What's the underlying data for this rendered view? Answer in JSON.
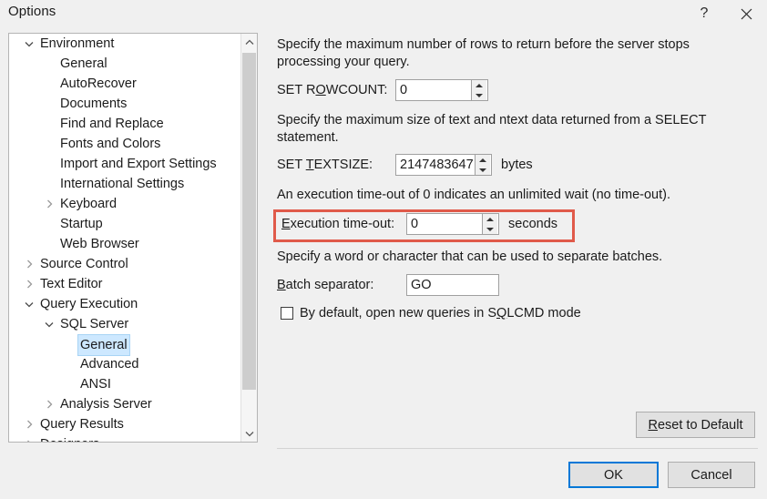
{
  "window": {
    "title": "Options",
    "help_icon": "question-mark-icon",
    "close_icon": "close-icon"
  },
  "tree": {
    "scroll_up_icon": "chevron-up-icon",
    "scroll_down_icon": "chevron-down-icon",
    "items": [
      {
        "label": "Environment",
        "depth": 0,
        "state": "expanded",
        "selected": false
      },
      {
        "label": "General",
        "depth": 1,
        "state": "leaf",
        "selected": false
      },
      {
        "label": "AutoRecover",
        "depth": 1,
        "state": "leaf",
        "selected": false
      },
      {
        "label": "Documents",
        "depth": 1,
        "state": "leaf",
        "selected": false
      },
      {
        "label": "Find and Replace",
        "depth": 1,
        "state": "leaf",
        "selected": false
      },
      {
        "label": "Fonts and Colors",
        "depth": 1,
        "state": "leaf",
        "selected": false
      },
      {
        "label": "Import and Export Settings",
        "depth": 1,
        "state": "leaf",
        "selected": false
      },
      {
        "label": "International Settings",
        "depth": 1,
        "state": "leaf",
        "selected": false
      },
      {
        "label": "Keyboard",
        "depth": 1,
        "state": "collapsed",
        "selected": false
      },
      {
        "label": "Startup",
        "depth": 1,
        "state": "leaf",
        "selected": false
      },
      {
        "label": "Web Browser",
        "depth": 1,
        "state": "leaf",
        "selected": false
      },
      {
        "label": "Source Control",
        "depth": 0,
        "state": "collapsed",
        "selected": false
      },
      {
        "label": "Text Editor",
        "depth": 0,
        "state": "collapsed",
        "selected": false
      },
      {
        "label": "Query Execution",
        "depth": 0,
        "state": "expanded",
        "selected": false
      },
      {
        "label": "SQL Server",
        "depth": 1,
        "state": "expanded",
        "selected": false
      },
      {
        "label": "General",
        "depth": 2,
        "state": "leaf",
        "selected": true
      },
      {
        "label": "Advanced",
        "depth": 2,
        "state": "leaf",
        "selected": false
      },
      {
        "label": "ANSI",
        "depth": 2,
        "state": "leaf",
        "selected": false
      },
      {
        "label": "Analysis Server",
        "depth": 1,
        "state": "collapsed",
        "selected": false
      },
      {
        "label": "Query Results",
        "depth": 0,
        "state": "collapsed",
        "selected": false
      },
      {
        "label": "Designers",
        "depth": 0,
        "state": "collapsed",
        "selected": false
      }
    ]
  },
  "panel": {
    "rowcount": {
      "description": "Specify the maximum number of rows to return before the server stops processing your query.",
      "label_pre": "SET R",
      "label_acc": "O",
      "label_post": "WCOUNT:",
      "value": "0"
    },
    "textsize": {
      "description": "Specify the maximum size of text and ntext data returned from a SELECT statement.",
      "label_pre": "SET ",
      "label_acc": "T",
      "label_post": "EXTSIZE:",
      "value": "2147483647",
      "unit": "bytes"
    },
    "timeout": {
      "description": "An execution time-out of 0 indicates an unlimited wait (no time-out).",
      "label_pre": "",
      "label_acc": "E",
      "label_post": "xecution time-out:",
      "value": "0",
      "unit": "seconds"
    },
    "batch": {
      "description": "Specify a word or character that can be used to separate batches.",
      "label_pre": "",
      "label_acc": "B",
      "label_post": "atch separator:",
      "value": "GO"
    },
    "sqlcmd": {
      "label_pre": "By default, open new queries in S",
      "label_acc": "Q",
      "label_post": "LCMD mode",
      "checked": false
    },
    "spin_up_icon": "triangle-up-icon",
    "spin_down_icon": "triangle-down-icon"
  },
  "buttons": {
    "reset_pre": "",
    "reset_acc": "R",
    "reset_post": "eset to Default",
    "ok": "OK",
    "cancel": "Cancel"
  },
  "annotation": {
    "color": "#e05a4a"
  }
}
